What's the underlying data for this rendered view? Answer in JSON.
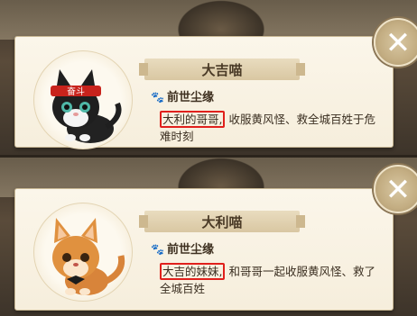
{
  "cards": [
    {
      "name": "大吉喵",
      "section_label": "前世尘缘",
      "headband_text": "奋斗",
      "desc_highlight": "大利的哥哥,",
      "desc_rest": " 收服黄风怪、救全城百姓于危难时刻",
      "icons": {
        "section": "paw-icon",
        "close": "close-icon"
      }
    },
    {
      "name": "大利喵",
      "section_label": "前世尘缘",
      "desc_highlight": "大吉的妹妹,",
      "desc_rest": " 和哥哥一起收服黄风怪、救了全城百姓",
      "icons": {
        "section": "paw-icon",
        "close": "close-icon"
      }
    }
  ],
  "colors": {
    "highlight_border": "#e0201c",
    "card_bg": "#fbf6ea"
  }
}
